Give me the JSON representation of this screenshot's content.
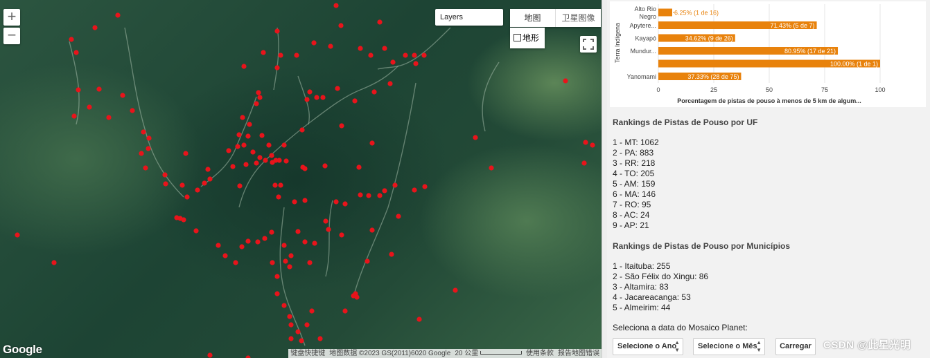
{
  "map": {
    "zoom_in": "+",
    "zoom_out": "−",
    "layers_label": "Layers",
    "maptype_map": "地图",
    "maptype_satellite": "卫星图像",
    "terrain_label": "地形",
    "logo": "Google",
    "attribution": {
      "shortcuts": "键盘快捷键",
      "data": "地图数据 ©2023 GS(2011)6020 Google",
      "scale": "20 公里",
      "terms": "使用条款",
      "report": "报告地图错误"
    },
    "marker_color": "#e8141b",
    "icons": [
      "plus-icon",
      "minus-icon",
      "fullscreen-icon",
      "checkbox-icon"
    ]
  },
  "chart_data": {
    "type": "bar",
    "orientation": "horizontal",
    "ylabel": "Terra Indígena",
    "xlabel": "Porcentagem de pistas de pouso à menos de 5 km de algum...",
    "xlim": [
      0,
      100
    ],
    "xticks": [
      "0",
      "25",
      "50",
      "75",
      "100"
    ],
    "bar_color": "#e8820c",
    "categories": [
      "Alto Rio Negro",
      "Apytere...",
      "Kayapó",
      "Mundur...",
      "",
      "Yanomami"
    ],
    "category_lines": [
      [
        "Alto Rio",
        "Negro"
      ],
      [
        "Apytere..."
      ],
      [
        "Kayapó"
      ],
      [
        "Mundur..."
      ],
      [
        ""
      ],
      [
        "Yanomami"
      ]
    ],
    "values": [
      6.25,
      71.43,
      34.62,
      80.95,
      100.0,
      37.33
    ],
    "labels": [
      "6.25% (1 de 16)",
      "71.43% (5 de 7)",
      "34.62% (9 de 26)",
      "80.95% (17 de 21)",
      "100.00% (1 de 1)",
      "37.33% (28 de 75)"
    ]
  },
  "uf": {
    "title": "Rankings de Pistas de Pouso por UF",
    "items": [
      "1 - MT: 1062",
      "2 - PA: 883",
      "3 - RR: 218",
      "4 - TO: 205",
      "5 - AM: 159",
      "6 - MA: 146",
      "7 - RO: 95",
      "8 - AC: 24",
      "9 - AP: 21"
    ]
  },
  "mun": {
    "title": "Rankings de Pistas de Pouso por Municípios",
    "items": [
      "1 - Itaituba: 255",
      "2 - São Félix do Xingu: 86",
      "3 - Altamira: 83",
      "4 - Jacareacanga: 53",
      "5 - Almeirim: 44"
    ]
  },
  "mosaic": {
    "label": "Seleciona a data do Mosaico Planet:",
    "year_select": "Selecione o Ano",
    "month_select": "Selecione o Mês",
    "load_button": "Carregar"
  },
  "watermark": "CSDN @此星光明"
}
